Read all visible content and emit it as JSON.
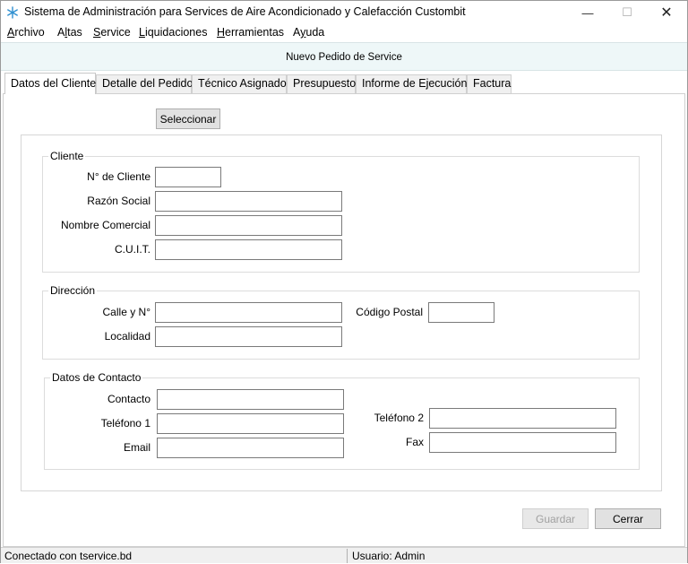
{
  "window": {
    "title": "Sistema de Administración para Services de Aire Acondicionado y Calefacción Custombit",
    "icon": "snowflake-icon",
    "controls": {
      "minimize": "—",
      "maximize": "☐",
      "close": "✕"
    }
  },
  "menu": [
    {
      "pre": "",
      "key": "A",
      "post": "rchivo"
    },
    {
      "pre": "A",
      "key": "l",
      "post": "tas"
    },
    {
      "pre": "",
      "key": "S",
      "post": "ervice"
    },
    {
      "pre": "",
      "key": "L",
      "post": "iquidaciones"
    },
    {
      "pre": "",
      "key": "H",
      "post": "erramientas"
    },
    {
      "pre": "A",
      "key": "y",
      "post": "uda"
    }
  ],
  "form_title": "Nuevo Pedido de Service",
  "tabs": [
    "Datos del Cliente",
    "Detalle del Pedido",
    "Técnico Asignado",
    "Presupuesto",
    "Informe de Ejecución",
    "Factura"
  ],
  "select_button": "Seleccionar",
  "cliente": {
    "legend": "Cliente",
    "numero_label": "N° de Cliente",
    "numero_value": "",
    "razon_label": "Razón Social",
    "razon_value": "",
    "nombre_label": "Nombre Comercial",
    "nombre_value": "",
    "cuit_label": "C.U.I.T.",
    "cuit_value": ""
  },
  "direccion": {
    "legend": "Dirección",
    "calle_label": "Calle y N°",
    "calle_value": "",
    "cp_label": "Código Postal",
    "cp_value": "",
    "localidad_label": "Localidad",
    "localidad_value": ""
  },
  "contacto": {
    "legend": "Datos de Contacto",
    "contacto_label": "Contacto",
    "contacto_value": "",
    "tel1_label": "Teléfono 1",
    "tel1_value": "",
    "email_label": "Email",
    "email_value": "",
    "tel2_label": "Teléfono 2",
    "tel2_value": "",
    "fax_label": "Fax",
    "fax_value": ""
  },
  "buttons": {
    "save": "Guardar",
    "close": "Cerrar"
  },
  "status": {
    "connection": "Conectado con tservice.bd",
    "user": "Usuario: Admin"
  }
}
